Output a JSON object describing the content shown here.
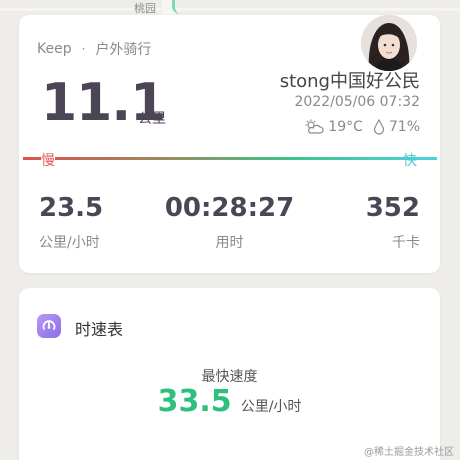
{
  "map": {
    "label": "桃园"
  },
  "summary": {
    "brand": "Keep",
    "separator": "·",
    "activity": "户外骑行",
    "distance": "11.1",
    "distance_unit": "公里",
    "username": "stong中国好公民",
    "datetime": "2022/05/06 07:32",
    "temperature": "19°C",
    "humidity": "71%",
    "speed_slow_label": "慢",
    "speed_fast_label": "快",
    "stats": [
      {
        "value": "23.5",
        "label": "公里/小时"
      },
      {
        "value": "00:28:27",
        "label": "用时"
      },
      {
        "value": "352",
        "label": "千卡"
      }
    ]
  },
  "speedometer": {
    "title": "时速表",
    "fastest_label": "最快速度",
    "fastest_value": "33.5",
    "fastest_unit": "公里/小时"
  },
  "watermark": "@稀土掘金技术社区",
  "colors": {
    "accent_green": "#2cbf7e",
    "slow_red": "#e45a5a",
    "fast_cyan": "#4fc8d6",
    "speedo_purple": "#8d6ce8"
  },
  "icons": [
    "avatar",
    "partly-cloudy-icon",
    "humidity-drop-icon",
    "speedometer-icon"
  ]
}
